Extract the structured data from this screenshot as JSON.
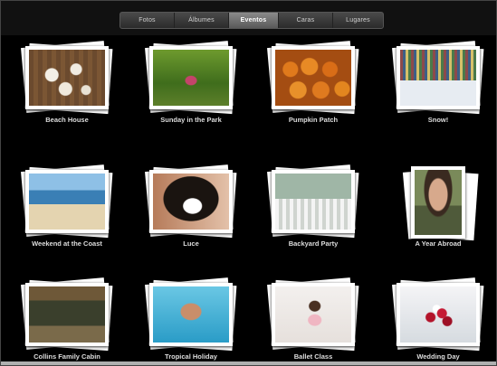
{
  "tabs": [
    {
      "label": "Fotos",
      "active": false
    },
    {
      "label": "Álbumes",
      "active": false
    },
    {
      "label": "Eventos",
      "active": true
    },
    {
      "label": "Caras",
      "active": false
    },
    {
      "label": "Lugares",
      "active": false
    }
  ],
  "events": [
    {
      "title": "Beach House"
    },
    {
      "title": "Sunday in the Park"
    },
    {
      "title": "Pumpkin Patch"
    },
    {
      "title": "Snow!"
    },
    {
      "title": "Weekend at the Coast"
    },
    {
      "title": "Luce"
    },
    {
      "title": "Backyard Party"
    },
    {
      "title": "A Year Abroad"
    },
    {
      "title": "Collins Family Cabin"
    },
    {
      "title": "Tropical Holiday"
    },
    {
      "title": "Ballet Class"
    },
    {
      "title": "Wedding Day"
    }
  ],
  "colors": {
    "background": "#000000",
    "active_tab": "#7a7a7a",
    "title_text": "#dddddd"
  }
}
